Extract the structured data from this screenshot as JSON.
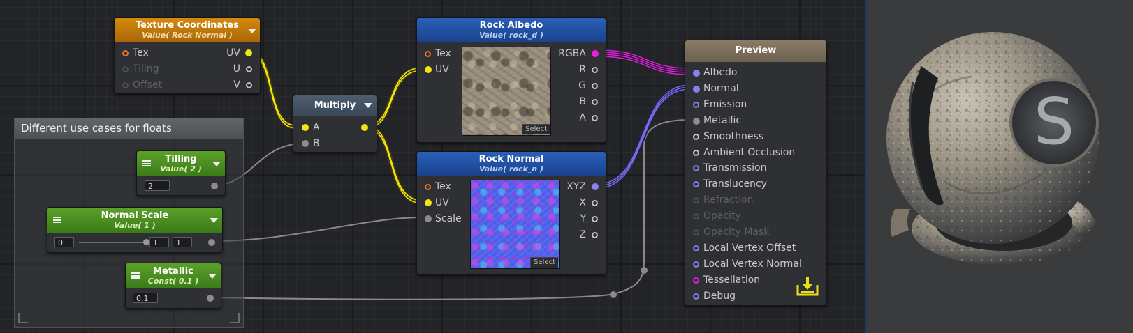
{
  "colors": {
    "canvas_bg": "#232427",
    "wire_yellow": "#f2e412",
    "wire_magenta": "#d028d0",
    "wire_purple": "#7b6ee6",
    "wire_grey": "#8a8a8a",
    "header_orange": "#c27b0a",
    "header_blue": "#2350a4",
    "header_green": "#4c8e20",
    "header_tan": "#7d705c"
  },
  "group": {
    "title": "Different use cases for floats"
  },
  "texcoord": {
    "title": "Texture Coordinates",
    "subtitle": "Value( Rock Normal )",
    "inputs": [
      "Tex",
      "Tiling",
      "Offset"
    ],
    "outputs": [
      "UV",
      "U",
      "V"
    ]
  },
  "multiply": {
    "title": "Multiply",
    "inputs": [
      "A",
      "B"
    ]
  },
  "albedo": {
    "title": "Rock Albedo",
    "subtitle": "Value( rock_d )",
    "inputs": [
      "Tex",
      "UV"
    ],
    "outputs": [
      "RGBA",
      "R",
      "G",
      "B",
      "A"
    ],
    "select_label": "Select"
  },
  "normal": {
    "title": "Rock Normal",
    "subtitle": "Value( rock_n )",
    "inputs": [
      "Tex",
      "UV",
      "Scale"
    ],
    "outputs": [
      "XYZ",
      "X",
      "Y",
      "Z"
    ],
    "select_label": "Select"
  },
  "tilling": {
    "title": "Tilling",
    "subtitle": "Value( 2 )",
    "value": "2"
  },
  "normal_scale": {
    "title": "Normal Scale",
    "subtitle": "Value( 1 )",
    "min": "0",
    "value": "1",
    "max": "1",
    "slider_fraction": 1.0
  },
  "metallic": {
    "title": "Metallic",
    "subtitle": "Const( 0.1 )",
    "value": "0.1"
  },
  "preview": {
    "title": "Preview",
    "inputs": [
      "Albedo",
      "Normal",
      "Emission",
      "Metallic",
      "Smoothness",
      "Ambient Occlusion",
      "Transmission",
      "Translucency",
      "Refraction",
      "Opacity",
      "Opacity Mask",
      "Local Vertex Offset",
      "Local Vertex Normal",
      "Tessellation",
      "Debug"
    ],
    "save_icon": "save-download-icon"
  },
  "viewport": {
    "logo_letter": "S"
  }
}
